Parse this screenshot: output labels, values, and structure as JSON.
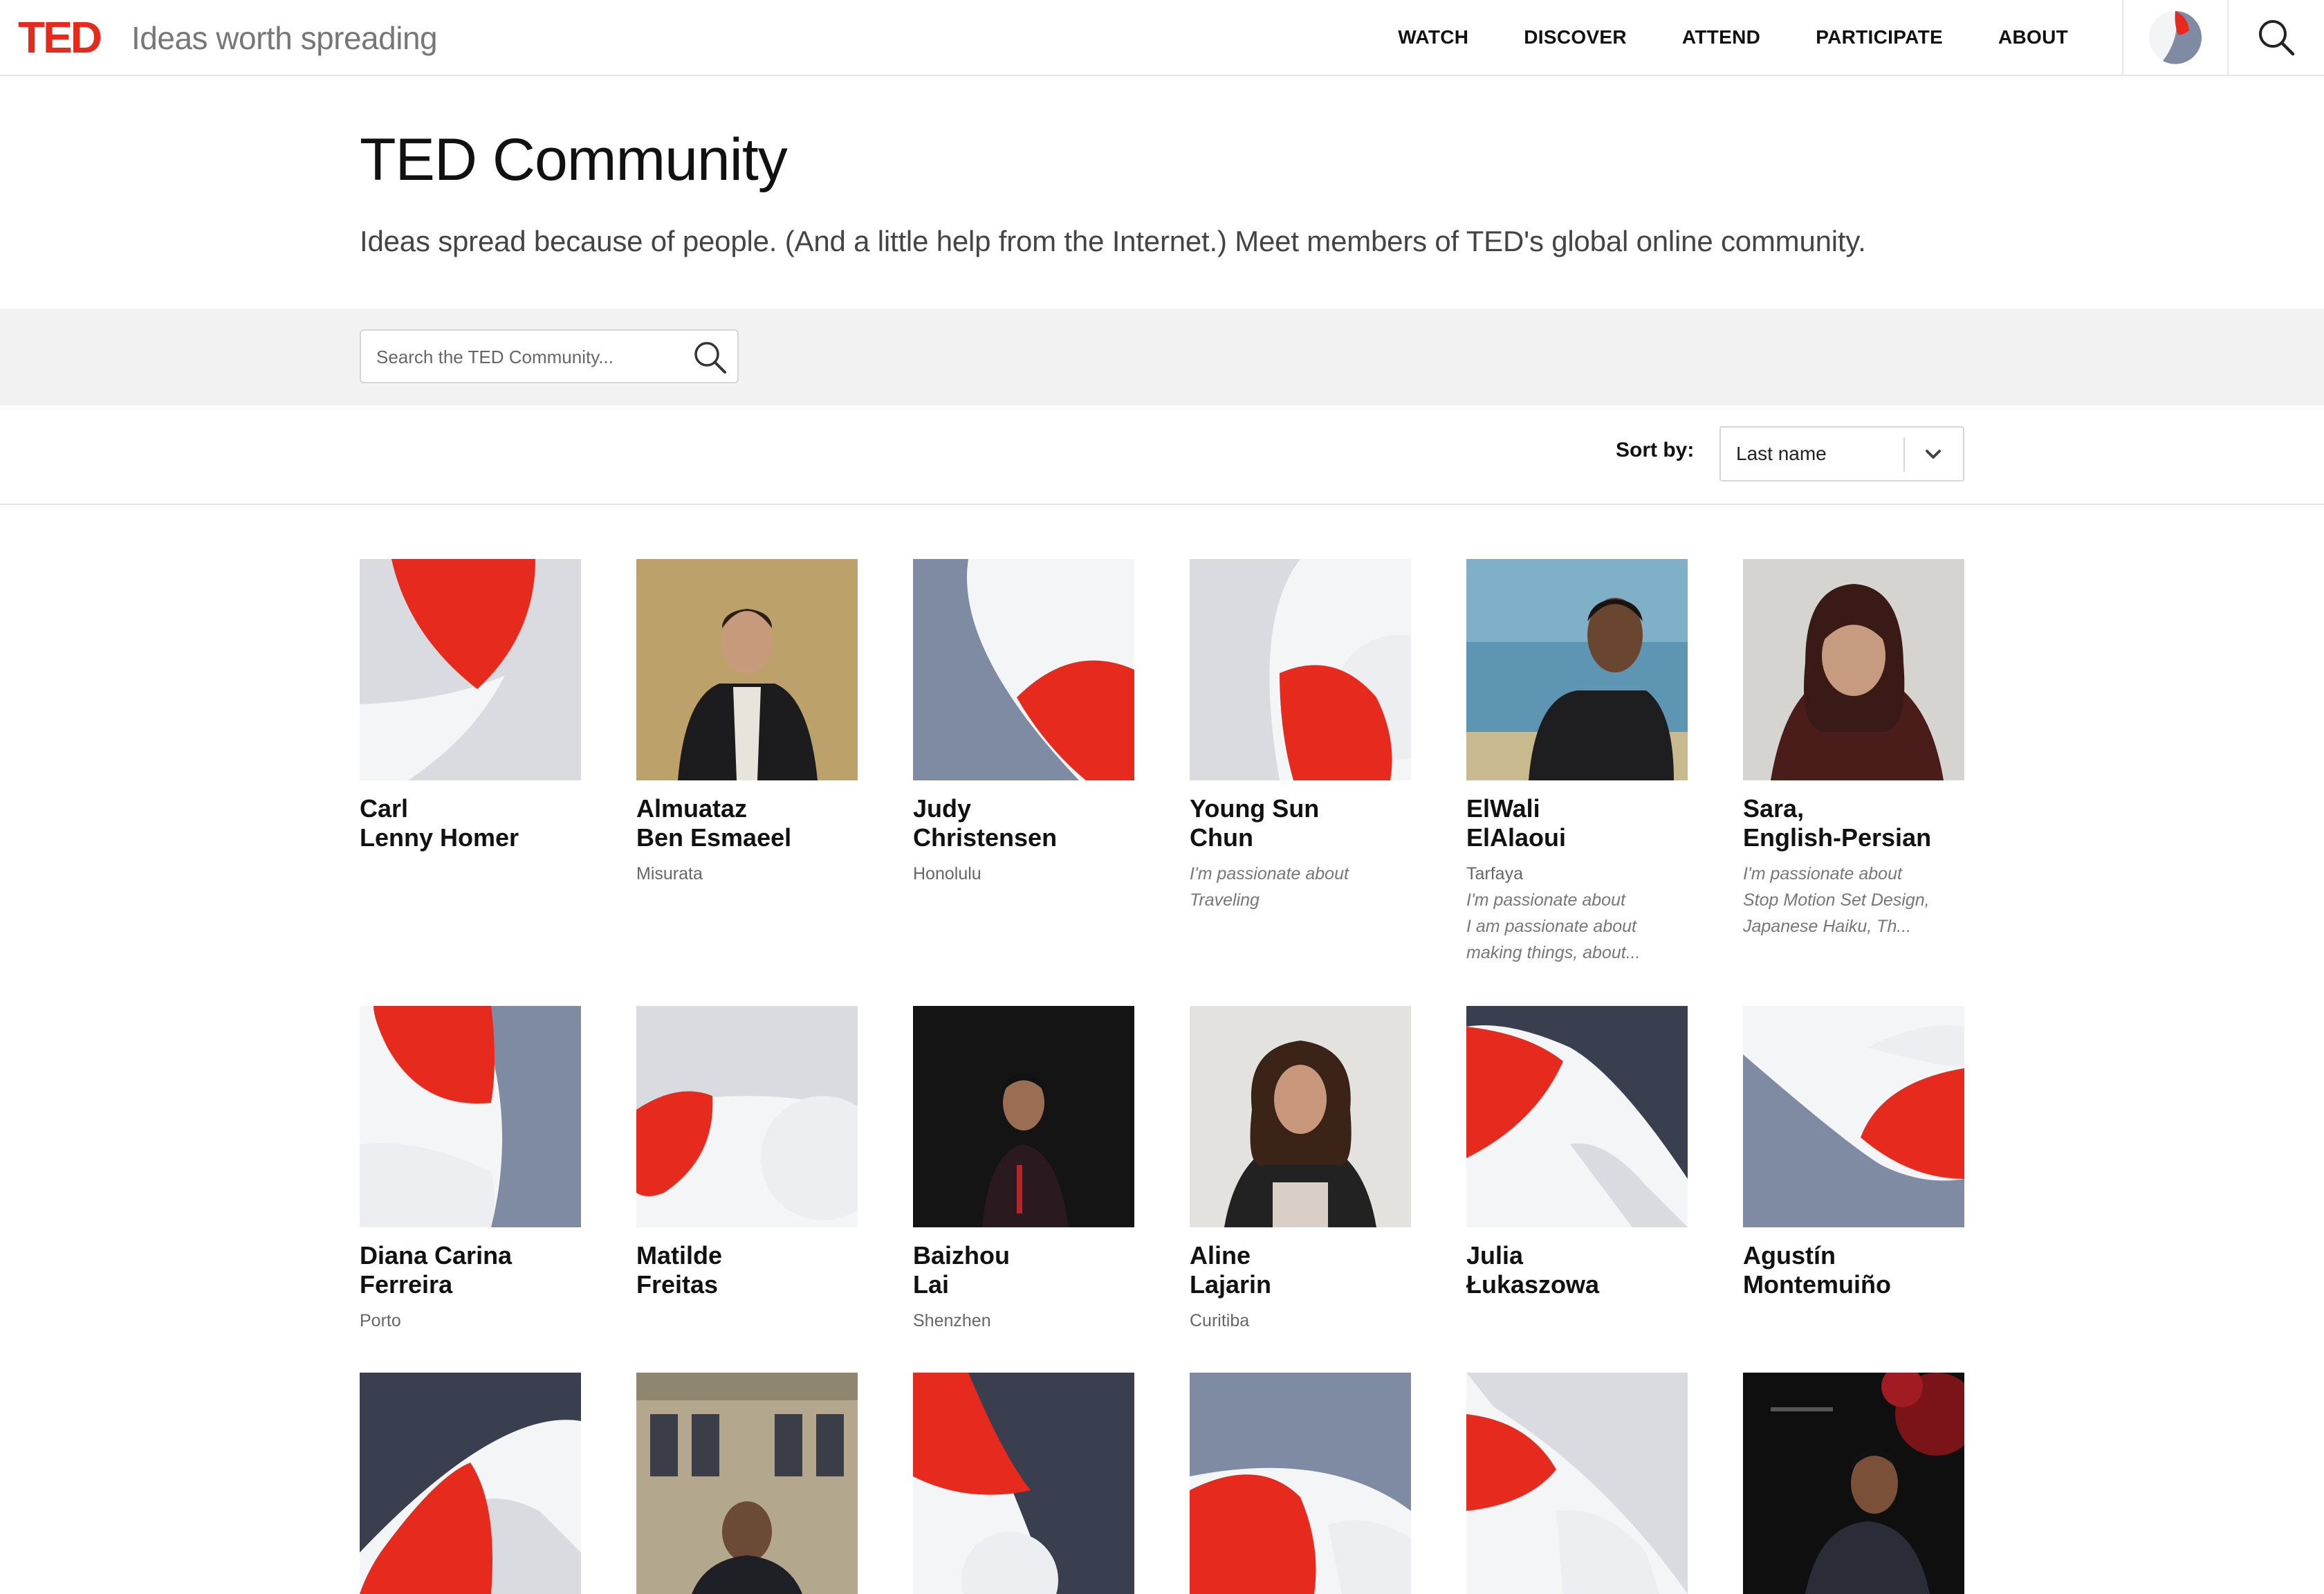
{
  "header": {
    "logo": "TED",
    "tagline": "Ideas worth spreading",
    "nav": [
      "WATCH",
      "DISCOVER",
      "ATTEND",
      "PARTICIPATE",
      "ABOUT"
    ],
    "user_icon": "user-avatar-icon",
    "search_icon": "search-icon"
  },
  "intro": {
    "title": "TED Community",
    "subtitle": "Ideas spread because of people. (And a little help from the Internet.) Meet members of TED's global online community."
  },
  "search": {
    "placeholder": "Search the TED Community..."
  },
  "sort": {
    "label": "Sort by:",
    "value": "Last name"
  },
  "colors": {
    "brand_red": "#e62b1e",
    "slate": "#7f8aa3",
    "dark": "#3a3f4f",
    "light_gray": "#d9dbe0",
    "pale": "#eef0f3"
  },
  "members": [
    {
      "first": "Carl",
      "last": "Lenny Homer",
      "location": "",
      "passion": []
    },
    {
      "first": "Almuataz",
      "last": "Ben Esmaeel",
      "location": "Misurata",
      "passion": []
    },
    {
      "first": "Judy",
      "last": "Christensen",
      "location": "Honolulu",
      "passion": []
    },
    {
      "first": "Young Sun",
      "last": "Chun",
      "location": "",
      "passion": [
        "I'm passionate about",
        "Traveling"
      ]
    },
    {
      "first": "ElWali",
      "last": "ElAlaoui",
      "location": "Tarfaya",
      "passion": [
        "I'm passionate about",
        "I am passionate about",
        "making things, about..."
      ]
    },
    {
      "first": "Sara,",
      "last": "English-Persian",
      "location": "",
      "passion": [
        "I'm passionate about",
        "Stop Motion Set Design,",
        "Japanese Haiku, Th..."
      ]
    },
    {
      "first": "Diana Carina",
      "last": "Ferreira",
      "location": "Porto",
      "passion": []
    },
    {
      "first": "Matilde",
      "last": "Freitas",
      "location": "",
      "passion": []
    },
    {
      "first": "Baizhou",
      "last": "Lai",
      "location": "Shenzhen",
      "passion": []
    },
    {
      "first": "Aline",
      "last": "Lajarin",
      "location": "Curitiba",
      "passion": []
    },
    {
      "first": "Julia",
      "last": "Łukaszowa",
      "location": "",
      "passion": []
    },
    {
      "first": "Agustín",
      "last": "Montemuiño",
      "location": "",
      "passion": []
    },
    {
      "first": "",
      "last": "",
      "location": "",
      "passion": []
    },
    {
      "first": "",
      "last": "",
      "location": "",
      "passion": []
    },
    {
      "first": "",
      "last": "",
      "location": "",
      "passion": []
    },
    {
      "first": "",
      "last": "",
      "location": "",
      "passion": []
    },
    {
      "first": "",
      "last": "",
      "location": "",
      "passion": []
    },
    {
      "first": "",
      "last": "",
      "location": "",
      "passion": []
    }
  ]
}
